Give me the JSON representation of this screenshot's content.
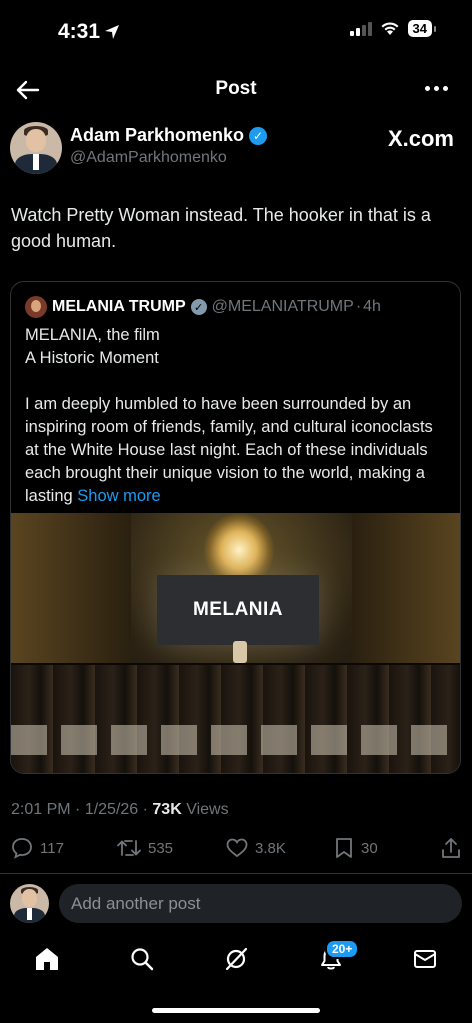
{
  "status_bar": {
    "time": "4:31",
    "battery": "34"
  },
  "header": {
    "title": "Post"
  },
  "author": {
    "name": "Adam Parkhomenko",
    "handle": "@AdamParkhomenko",
    "source": "X.com"
  },
  "post": {
    "text": "Watch Pretty Woman instead. The hooker in that is a good human."
  },
  "quoted": {
    "name": "MELANIA TRUMP",
    "handle": "@MELANIATRUMP",
    "separator": "·",
    "time": "4h",
    "line1": "MELANIA, the film",
    "line2": "A Historic Moment",
    "body": "I am deeply humbled to have been surrounded by an inspiring room of friends, family, and cultural iconoclasts at the White House last night.  Each of these individuals each brought their unique vision to the world, making a lasting ",
    "show_more": "Show more",
    "image_text": "MELANIA"
  },
  "meta": {
    "time": "2:01 PM · 1/25/26 · ",
    "views_count": "73K",
    "views_label": " Views"
  },
  "actions": {
    "replies": "117",
    "reposts": "535",
    "likes": "3.8K",
    "bookmarks": "30"
  },
  "reply": {
    "placeholder": "Add another post"
  },
  "tabbar": {
    "notifications_badge": "20+"
  },
  "colors": {
    "accent": "#1d9bf0",
    "muted": "#71767b",
    "background": "#000000"
  },
  "icons": [
    "back-arrow-icon",
    "more-icon",
    "verified-icon",
    "reply-icon",
    "repost-icon",
    "like-icon",
    "bookmark-icon",
    "share-icon",
    "home-icon",
    "search-icon",
    "grok-icon",
    "bell-icon",
    "mail-icon"
  ]
}
